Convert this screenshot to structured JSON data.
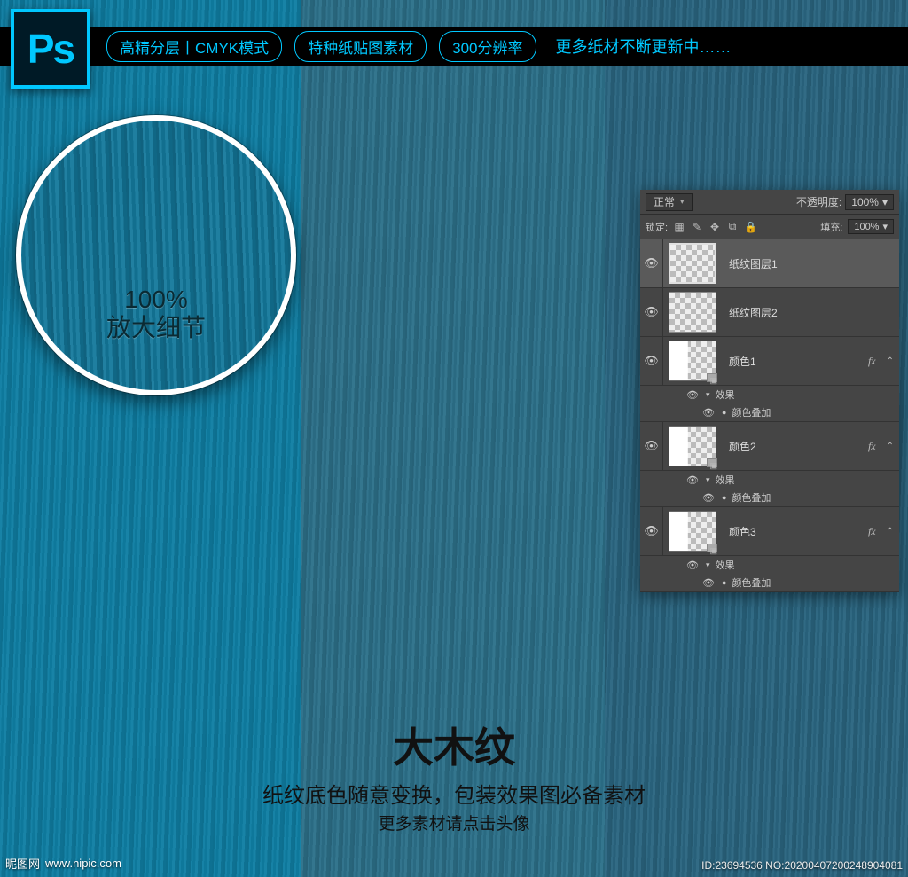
{
  "ps_badge": "Ps",
  "top_pills": [
    "高精分层丨CMYK模式",
    "特种纸贴图素材",
    "300分辨率"
  ],
  "top_tail": "更多纸材不断更新中……",
  "zoom_label_l1": "100%",
  "zoom_label_l2": "放大细节",
  "title": {
    "t1": "大木纹",
    "t2": "纸纹底色随意变换，包装效果图必备素材",
    "t3": "更多素材请点击头像"
  },
  "footer_left_brand": "昵图网",
  "footer_left_url": "www.nipic.com",
  "footer_right": "ID:23694536 NO:20200407200248904081",
  "panel": {
    "blend_mode": "正常",
    "opacity_label": "不透明度:",
    "opacity_val": "100%",
    "lock_label": "锁定:",
    "fill_label": "填充:",
    "fill_val": "100%",
    "effects_label": "效果",
    "overlay_label": "颜色叠加",
    "layers": [
      {
        "name": "纸纹图层1",
        "selected": true,
        "has_fx": false,
        "color": false
      },
      {
        "name": "纸纹图层2",
        "selected": false,
        "has_fx": false,
        "color": false
      },
      {
        "name": "颜色1",
        "selected": false,
        "has_fx": true,
        "color": true
      },
      {
        "name": "颜色2",
        "selected": false,
        "has_fx": true,
        "color": true
      },
      {
        "name": "颜色3",
        "selected": false,
        "has_fx": true,
        "color": true
      }
    ]
  }
}
